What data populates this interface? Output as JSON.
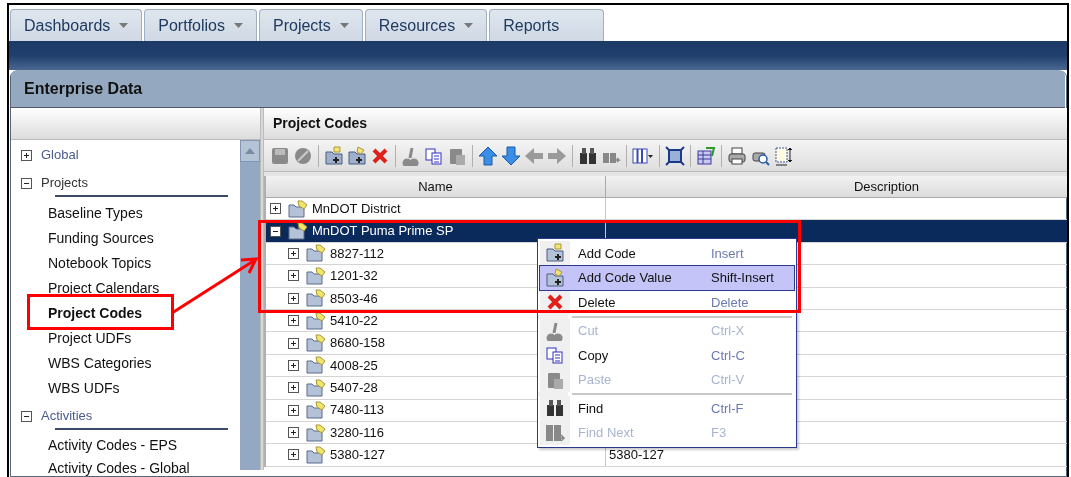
{
  "tabs": [
    {
      "label": "Dashboards",
      "has_menu": true,
      "selected": false
    },
    {
      "label": "Portfolios",
      "has_menu": true,
      "selected": false
    },
    {
      "label": "Projects",
      "has_menu": true,
      "selected": false
    },
    {
      "label": "Resources",
      "has_menu": true,
      "selected": false
    },
    {
      "label": "Reports",
      "has_menu": false,
      "selected": false
    }
  ],
  "panel": {
    "title": "Enterprise Data"
  },
  "sidebar": {
    "groups": [
      {
        "label": "Global",
        "expanded": false
      },
      {
        "label": "Projects",
        "expanded": true,
        "items": [
          {
            "label": "Baseline Types",
            "selected": false
          },
          {
            "label": "Funding Sources",
            "selected": false
          },
          {
            "label": "Notebook Topics",
            "selected": false
          },
          {
            "label": "Project Calendars",
            "selected": false
          },
          {
            "label": "Project Codes",
            "selected": true
          },
          {
            "label": "Project UDFs",
            "selected": false
          },
          {
            "label": "WBS Categories",
            "selected": false
          },
          {
            "label": "WBS UDFs",
            "selected": false
          }
        ]
      },
      {
        "label": "Activities",
        "expanded": true,
        "items": [
          {
            "label": "Activity Codes - EPS",
            "selected": false
          },
          {
            "label": "Activity Codes - Global",
            "selected": false
          }
        ]
      }
    ]
  },
  "content": {
    "title": "Project Codes"
  },
  "table": {
    "columns": [
      "Name",
      "Description"
    ],
    "rows": [
      {
        "name": "MnDOT District",
        "expanded": false,
        "selected": false
      },
      {
        "name": "MnDOT Puma Prime SP",
        "expanded": true,
        "selected": true,
        "children": [
          {
            "name": "8827-112",
            "expanded": false,
            "selected": false
          },
          {
            "name": "1201-32",
            "expanded": false,
            "selected": false
          },
          {
            "name": "8503-46",
            "expanded": false,
            "selected": false
          },
          {
            "name": "5410-22",
            "expanded": false,
            "selected": false
          },
          {
            "name": "8680-158",
            "expanded": false,
            "selected": false
          },
          {
            "name": "4008-25",
            "expanded": false,
            "selected": false
          },
          {
            "name": "5407-28",
            "expanded": false,
            "selected": false
          },
          {
            "name": "7480-113",
            "expanded": false,
            "selected": false
          },
          {
            "name": "3280-116",
            "expanded": false,
            "selected": false
          },
          {
            "name": "5380-127",
            "description": "5380-127",
            "expanded": false,
            "selected": false
          }
        ]
      }
    ]
  },
  "context_menu": {
    "items": [
      {
        "kind": "add-code",
        "label": "Add Code",
        "shortcut": "Insert",
        "disabled": false,
        "selected": false
      },
      {
        "kind": "add-value",
        "label": "Add Code Value",
        "shortcut": "Shift-Insert",
        "disabled": false,
        "selected": true
      },
      {
        "kind": "delete",
        "label": "Delete",
        "shortcut": "Delete",
        "disabled": false,
        "selected": false
      },
      {
        "kind": "separator"
      },
      {
        "kind": "cut",
        "label": "Cut",
        "shortcut": "Ctrl-X",
        "disabled": true,
        "selected": false
      },
      {
        "kind": "copy",
        "label": "Copy",
        "shortcut": "Ctrl-C",
        "disabled": false,
        "selected": false
      },
      {
        "kind": "paste",
        "label": "Paste",
        "shortcut": "Ctrl-V",
        "disabled": true,
        "selected": false
      },
      {
        "kind": "separator"
      },
      {
        "kind": "find",
        "label": "Find",
        "shortcut": "Ctrl-F",
        "disabled": false,
        "selected": false
      },
      {
        "kind": "find-next",
        "label": "Find Next",
        "shortcut": "F3",
        "disabled": true,
        "selected": false
      }
    ]
  }
}
